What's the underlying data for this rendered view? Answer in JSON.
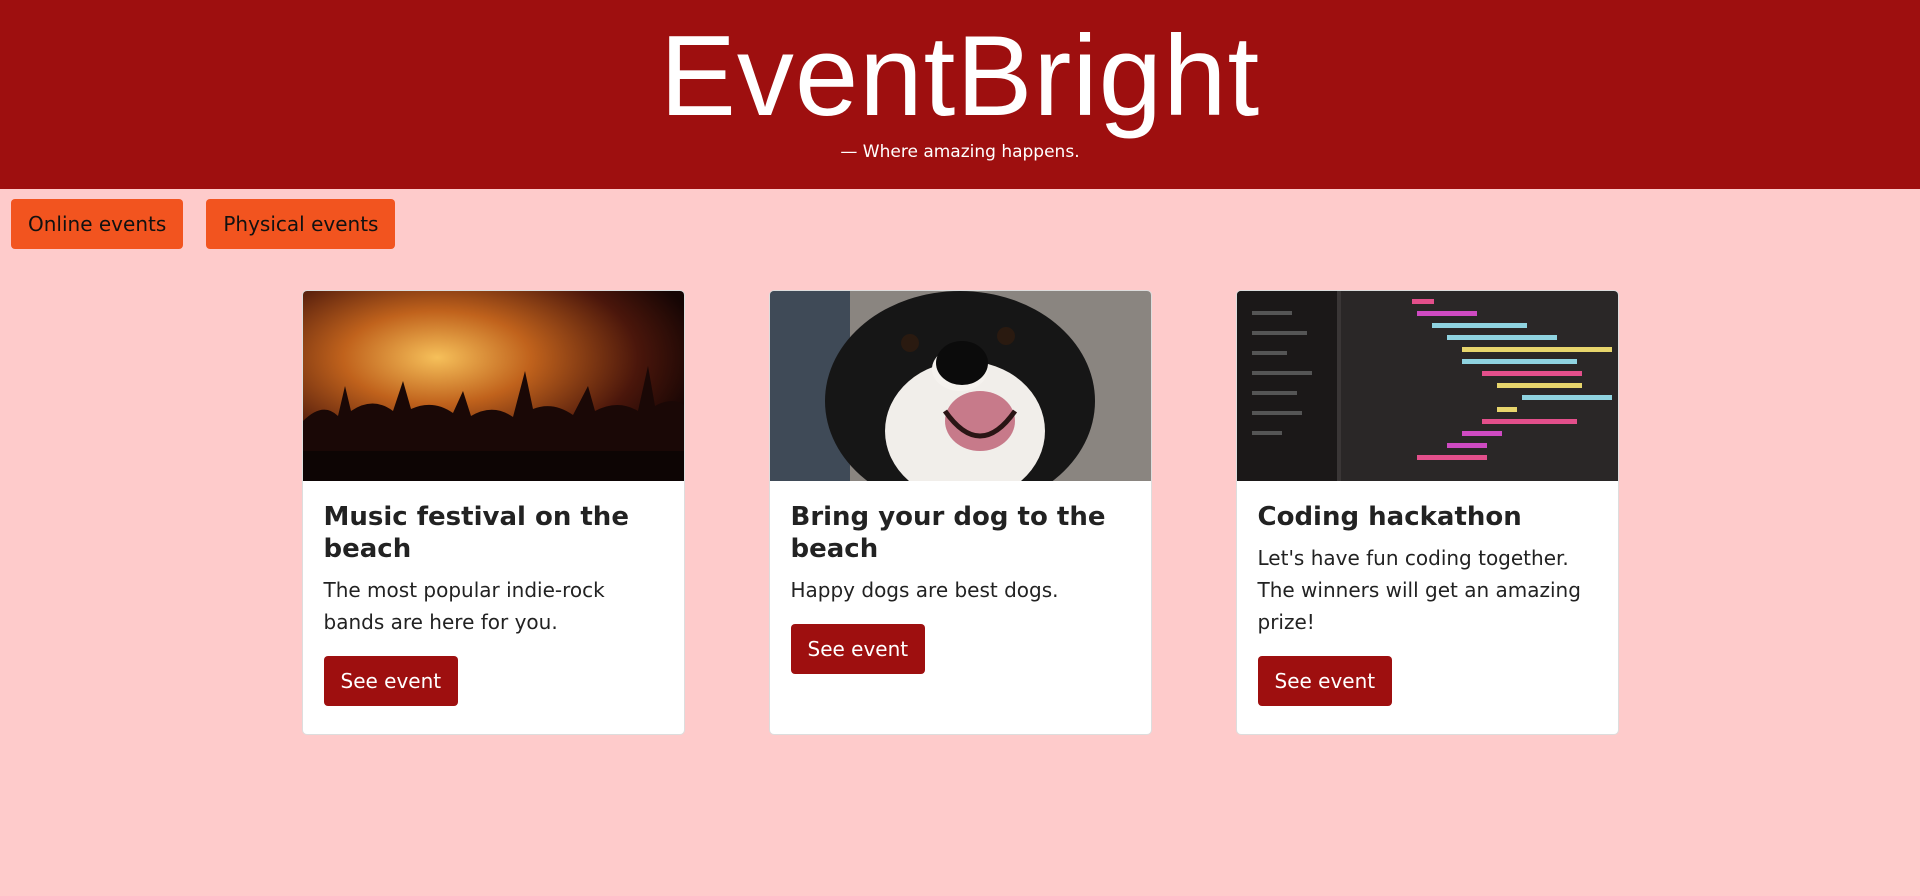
{
  "header": {
    "brand": "EventBright",
    "tagline": "— Where amazing happens."
  },
  "nav": {
    "online_label": "Online events",
    "physical_label": "Physical events"
  },
  "cards": [
    {
      "title": "Music festival on the beach",
      "text": "The most popular indie-rock bands are here for you.",
      "button": "See event",
      "image": "concert-crowd-image"
    },
    {
      "title": "Bring your dog to the beach",
      "text": "Happy dogs are best dogs.",
      "button": "See event",
      "image": "dog-image"
    },
    {
      "title": "Coding hackathon",
      "text": "Let's have fun coding together. The winners will get an amazing prize!",
      "button": "See event",
      "image": "code-screen-image"
    }
  ]
}
